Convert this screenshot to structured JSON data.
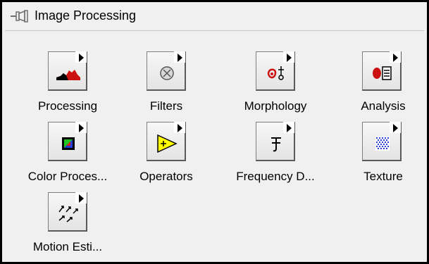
{
  "palette": {
    "title": "Image Processing",
    "items": [
      {
        "label": "Processing",
        "icon": "histogram-icon"
      },
      {
        "label": "Filters",
        "icon": "filter-circle-icon"
      },
      {
        "label": "Morphology",
        "icon": "morphology-icon"
      },
      {
        "label": "Analysis",
        "icon": "analysis-icon"
      },
      {
        "label": "Color Proces...",
        "icon": "color-square-icon"
      },
      {
        "label": "Operators",
        "icon": "operator-triangle-icon"
      },
      {
        "label": "Frequency D...",
        "icon": "frequency-domain-icon"
      },
      {
        "label": "Texture",
        "icon": "texture-grid-icon"
      },
      {
        "label": "Motion Esti...",
        "icon": "motion-arrows-icon"
      }
    ]
  },
  "colors": {
    "background": "#f0f0f0",
    "border": "#000000",
    "histogram_red": "#cc1111",
    "operator_yellow": "#ffff00",
    "texture_blue": "#2a3fd6"
  }
}
